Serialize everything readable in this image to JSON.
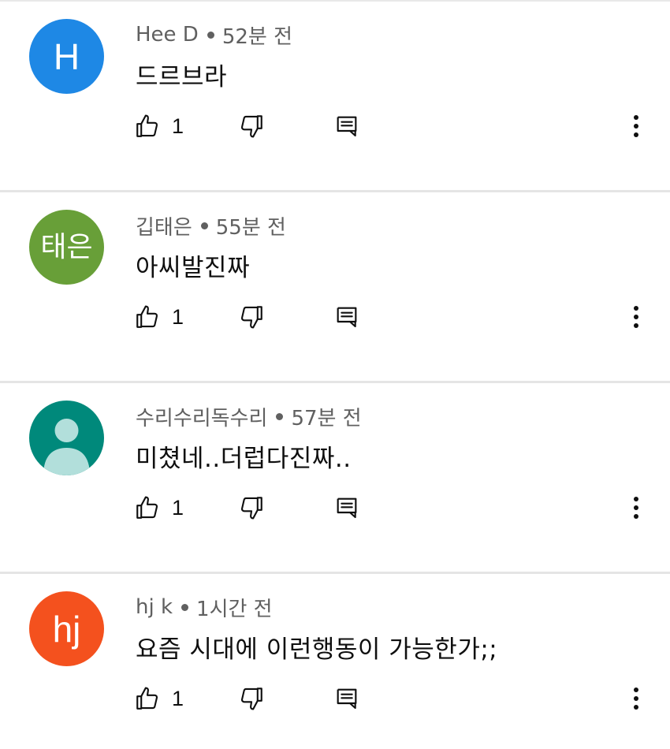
{
  "comments": [
    {
      "author": "Hee D",
      "time": "52분 전",
      "text": "드르브라",
      "avatar": {
        "type": "initial",
        "label": "H",
        "color": "#1e88e5"
      },
      "likes": "1"
    },
    {
      "author": "깁태은",
      "time": "55분 전",
      "text": "아씨발진짜",
      "avatar": {
        "type": "initial",
        "label": "태은",
        "color": "#689f38"
      },
      "likes": "1"
    },
    {
      "author": "수리수리독수리",
      "time": "57분 전",
      "text": "미쳤네..더럽다진짜..",
      "avatar": {
        "type": "default-person",
        "color": "#00897b"
      },
      "likes": "1"
    },
    {
      "author": "hj k",
      "time": "1시간 전",
      "text": "요즘 시대에 이런행동이 가능한가;;",
      "avatar": {
        "type": "initial",
        "label": "hj",
        "color": "#f4511e"
      },
      "likes": "1"
    }
  ],
  "icons": {
    "like": "thumbs-up-icon",
    "dislike": "thumbs-down-icon",
    "reply": "reply-comment-icon",
    "more": "more-vertical-icon"
  }
}
